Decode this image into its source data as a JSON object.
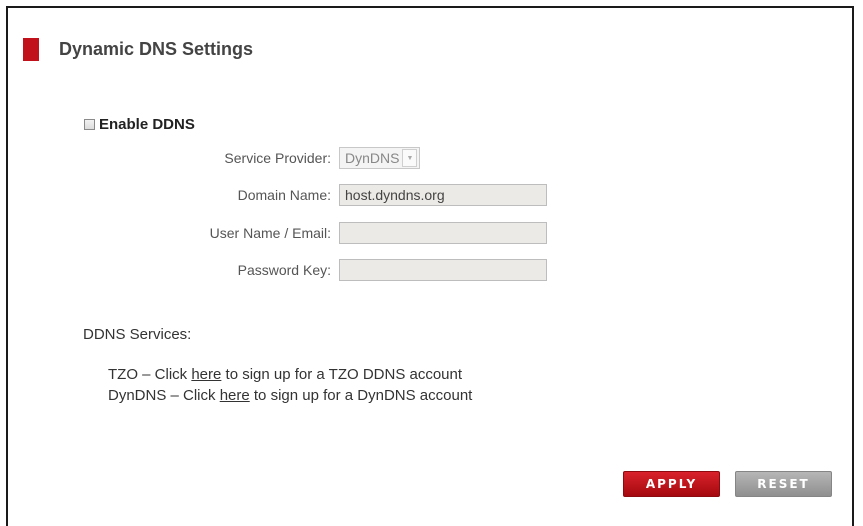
{
  "header": {
    "title": "Dynamic DNS Settings"
  },
  "enable_ddns": {
    "label": "Enable DDNS",
    "checked": false
  },
  "form": {
    "service_provider": {
      "label": "Service Provider:",
      "value": "DynDNS"
    },
    "domain_name": {
      "label": "Domain Name:",
      "value": "host.dyndns.org"
    },
    "user_name": {
      "label": "User Name / Email:",
      "value": ""
    },
    "password_key": {
      "label": "Password Key:",
      "value": ""
    }
  },
  "services": {
    "heading": "DDNS Services:",
    "items": [
      {
        "prefix": "TZO – Click ",
        "link": "here",
        "suffix": " to sign up for a TZO DDNS account"
      },
      {
        "prefix": "DynDNS – Click ",
        "link": "here",
        "suffix": " to sign up for a DynDNS account"
      }
    ]
  },
  "buttons": {
    "apply": "APPLY",
    "reset": "RESET"
  },
  "colors": {
    "accent": "#c1121c",
    "apply_bg": "#c0131b",
    "reset_bg": "#a3a3a3"
  }
}
